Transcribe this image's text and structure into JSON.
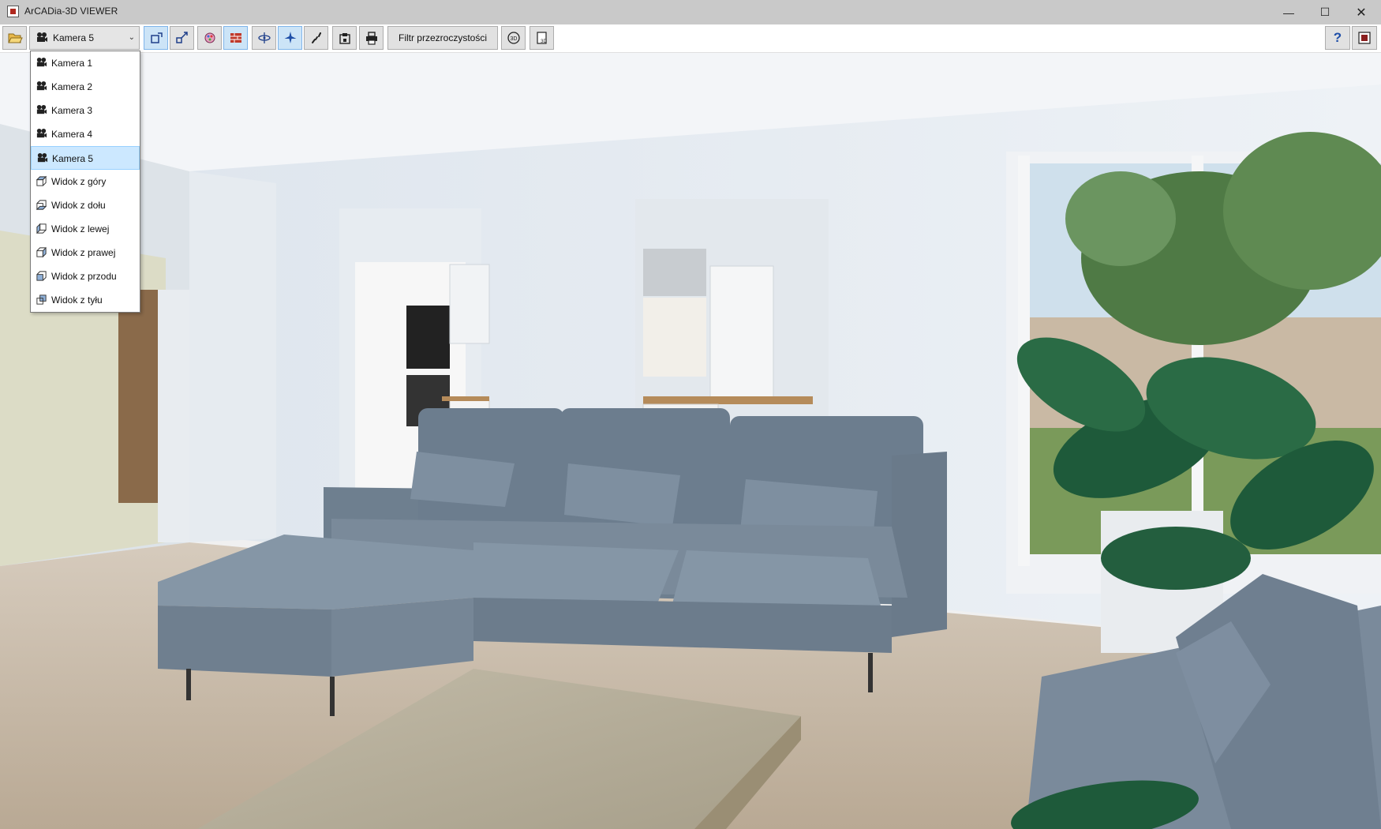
{
  "window": {
    "title": "ArCADia-3D VIEWER"
  },
  "toolbar": {
    "camera_select": {
      "value": "Kamera 5"
    },
    "filter_button": "Filtr przezroczystości",
    "buttons": [
      {
        "name": "open-folder-icon"
      },
      {
        "name": "select-object-icon",
        "active": true
      },
      {
        "name": "transform-object-icon"
      },
      {
        "name": "material-palette-icon"
      },
      {
        "name": "texture-wall-icon",
        "active": true
      },
      {
        "name": "orbit-camera-icon"
      },
      {
        "name": "fly-mode-icon",
        "active": true
      },
      {
        "name": "walk-mode-icon"
      },
      {
        "name": "save-image-icon"
      },
      {
        "name": "print-icon"
      },
      {
        "name": "rotate-3d-icon"
      },
      {
        "name": "export-3d-icon"
      },
      {
        "name": "help-icon"
      },
      {
        "name": "exit-icon"
      }
    ]
  },
  "camera_menu": {
    "items": [
      {
        "label": "Kamera 1",
        "icon": "camera-icon"
      },
      {
        "label": "Kamera 2",
        "icon": "camera-icon"
      },
      {
        "label": "Kamera 3",
        "icon": "camera-icon"
      },
      {
        "label": "Kamera 4",
        "icon": "camera-icon"
      },
      {
        "label": "Kamera 5",
        "icon": "camera-icon",
        "selected": true
      },
      {
        "label": "Widok z góry",
        "icon": "view-top-icon"
      },
      {
        "label": "Widok z dołu",
        "icon": "view-bottom-icon"
      },
      {
        "label": "Widok z lewej",
        "icon": "view-left-icon"
      },
      {
        "label": "Widok z prawej",
        "icon": "view-right-icon"
      },
      {
        "label": "Widok z przodu",
        "icon": "view-front-icon"
      },
      {
        "label": "Widok z tyłu",
        "icon": "view-back-icon"
      }
    ]
  },
  "colors": {
    "accent_active": "#cce4f7",
    "menu_selected": "#cce8ff",
    "help_blue": "#1f4fa8"
  }
}
